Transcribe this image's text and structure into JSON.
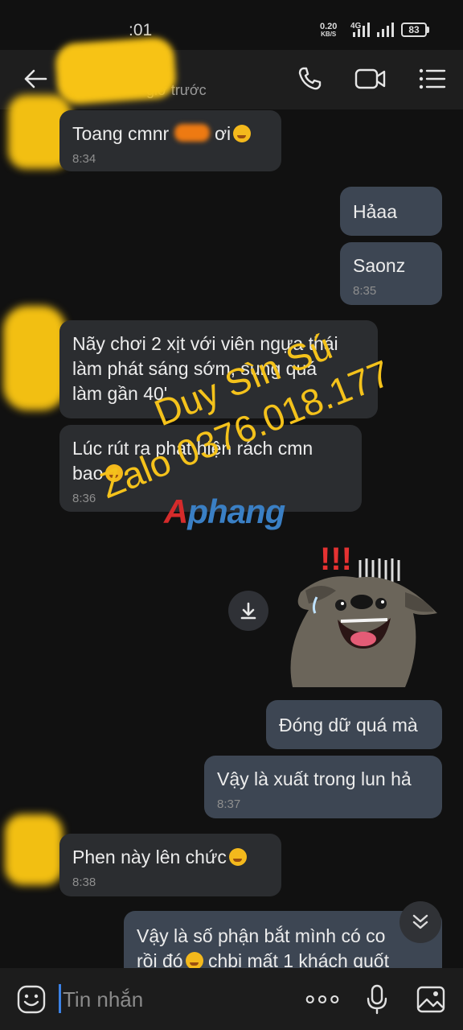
{
  "status": {
    "time": ":01",
    "net_speed": "0.20",
    "net_unit": "KB/S",
    "network": "4G",
    "battery": "83"
  },
  "header": {
    "subtitle": "giờ trước",
    "icons": [
      "back-arrow-icon",
      "phone-icon",
      "video-call-icon",
      "menu-icon"
    ]
  },
  "messages": [
    {
      "dir": "in",
      "text": "Toang cmnr",
      "suffix": "ơi",
      "emoji": "woozy-face",
      "time": "8:34"
    },
    {
      "dir": "out",
      "text": "Hảaa"
    },
    {
      "dir": "out",
      "text": "Saonz",
      "time": "8:35"
    },
    {
      "dir": "in",
      "text": "Nãy chơi 2 xịt với viên ngựa thái\nlàm phát sáng sớm, sung quá\nlàm gần 40'"
    },
    {
      "dir": "in",
      "text": "Lúc rút ra phát hiện rách cmn\nbao",
      "emoji": "woozy-face",
      "time": "8:36"
    },
    {
      "dir": "in",
      "type": "sticker",
      "sticker": "shocked-dog-sticker"
    },
    {
      "dir": "out",
      "text": "Đóng dữ quá mà"
    },
    {
      "dir": "out",
      "text": "Vậy là xuất trong lun hả",
      "time": "8:37"
    },
    {
      "dir": "in",
      "text": "Phen này lên chức",
      "emoji": "laughing-tears-face",
      "time": "8:38"
    },
    {
      "dir": "out",
      "text": "Vậy là số phận bắt mình có co\nrồi đó",
      "after_emoji": "chbi mất 1 khách quốt",
      "emoji": "thinking-face"
    }
  ],
  "watermark": {
    "line1": "Duy Sìn Sú",
    "line2": "Zalo 0376.018.177",
    "logo_a": "A",
    "logo_rest": "phang"
  },
  "input": {
    "placeholder": "Tin nhắn",
    "value": ""
  },
  "colors": {
    "incoming": "#2b2d30",
    "outgoing": "#3d4653",
    "background": "#111111",
    "accent": "#3b82e6",
    "watermark": "#f4c21b"
  }
}
